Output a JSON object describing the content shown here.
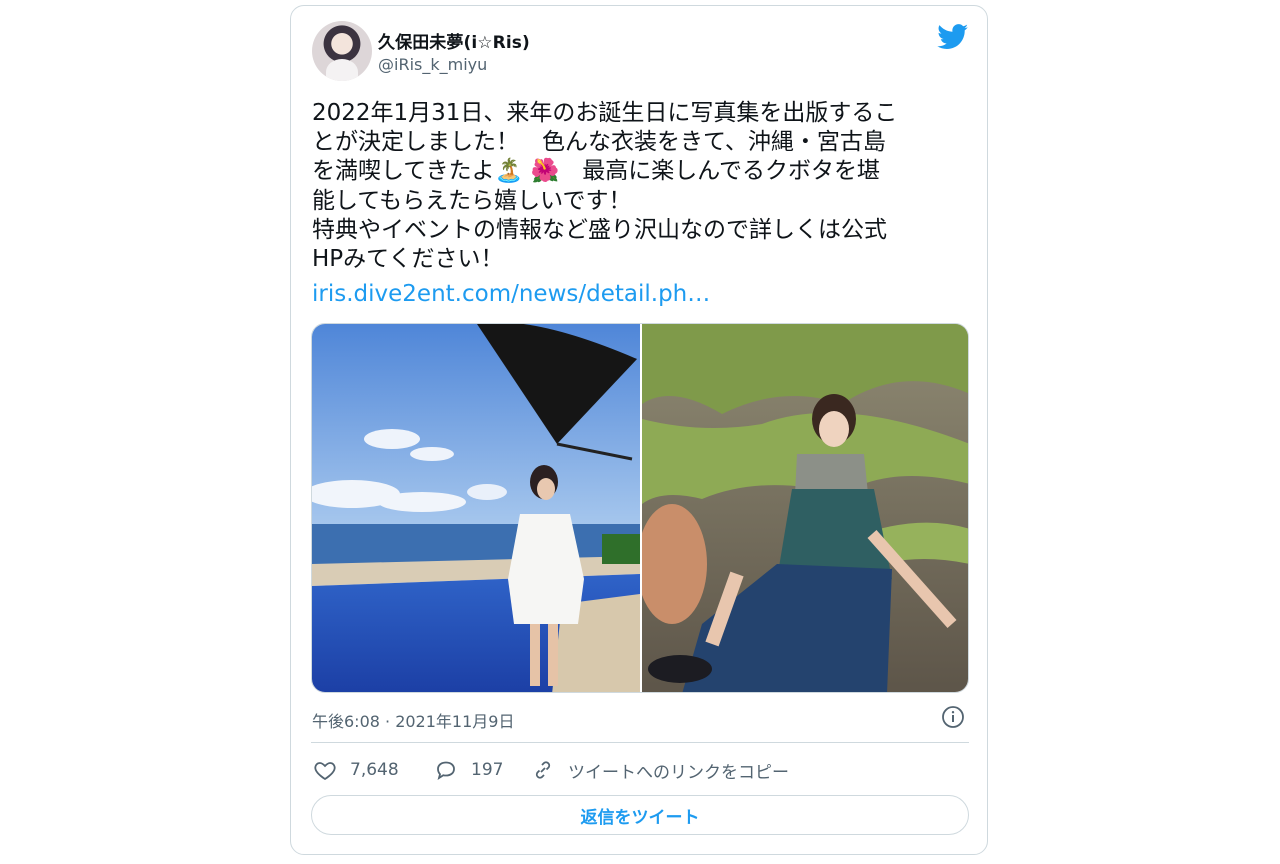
{
  "author": {
    "display_name": "久保田未夢(i☆Ris)",
    "handle": "@iRis_k_miyu",
    "avatar_icon": "profile-avatar"
  },
  "tweet": {
    "text": "2022年1月31日、来年のお誕生日に写真集を出版するこ\nとが決定しました！　色んな衣装をきて、沖縄・宮古島\nを満喫してきたよ🏝️ 🌺　最高に楽しんでるクボタを堪\n能してもらえたら嬉しいです！\n特典やイベントの情報など盛り沢山なので詳しくは公式\nHPみてください！",
    "link": "iris.dive2ent.com/news/detail.ph…",
    "timestamp": "午後6:08 · 2021年11月9日"
  },
  "actions": {
    "likes": "7,648",
    "replies": "197",
    "copy_link": "ツイートへのリンクをコピー",
    "reply_button": "返信をツイート"
  },
  "colors": {
    "accent": "#1d9bf0",
    "secondary_text": "#536471",
    "border": "#cfd9de"
  },
  "icons": [
    "twitter-bird-icon",
    "info-icon",
    "heart-icon",
    "reply-bubble-icon",
    "link-icon"
  ]
}
